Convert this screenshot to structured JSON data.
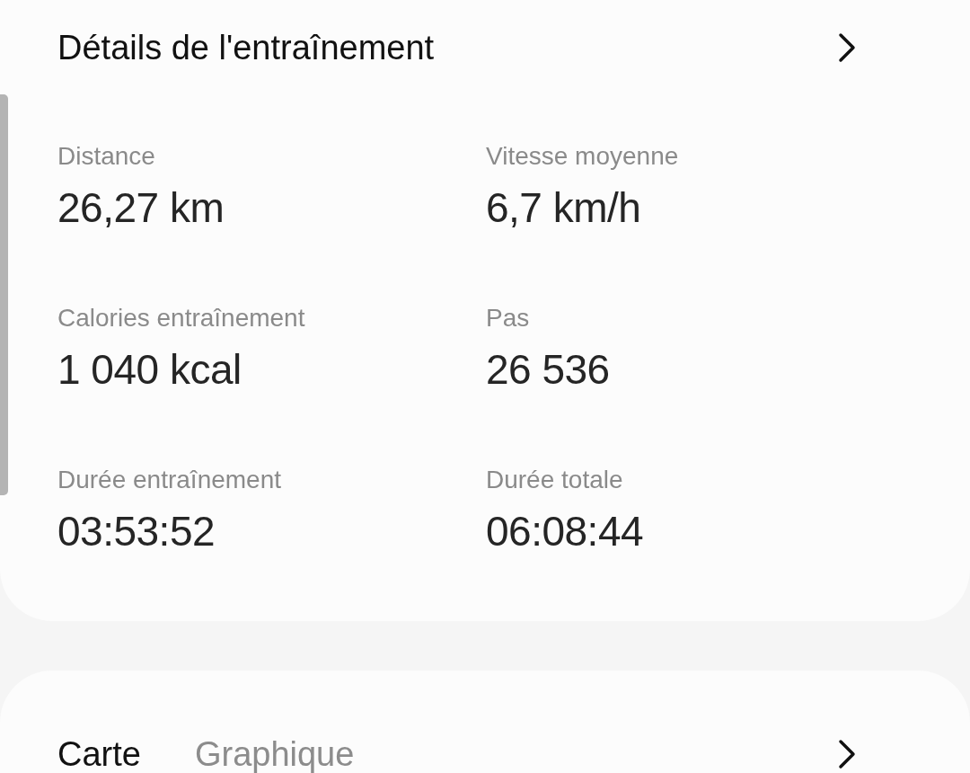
{
  "header": {
    "title": "Détails de l'entraînement"
  },
  "stats": [
    {
      "label": "Distance",
      "value": "26,27 km"
    },
    {
      "label": "Vitesse moyenne",
      "value": "6,7 km/h"
    },
    {
      "label": "Calories entraînement",
      "value": "1 040 kcal"
    },
    {
      "label": "Pas",
      "value": "26 536"
    },
    {
      "label": "Durée entraînement",
      "value": "03:53:52"
    },
    {
      "label": "Durée totale",
      "value": "06:08:44"
    }
  ],
  "tabs": [
    {
      "label": "Carte",
      "selected": true
    },
    {
      "label": "Graphique",
      "selected": false
    }
  ]
}
